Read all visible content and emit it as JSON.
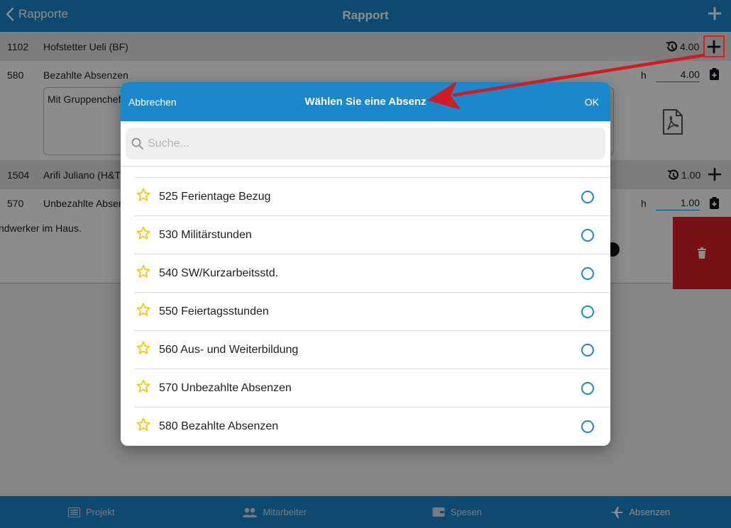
{
  "navbar": {
    "back_label": "Rapporte",
    "title": "Rapport"
  },
  "rows": [
    {
      "num": "1102",
      "name": "Hofstetter Ueli (BF)",
      "hours": "4.00"
    },
    {
      "num": "580",
      "name": "Bezahlte Absenzen",
      "unit": "h",
      "value": "4.00"
    },
    {
      "num": "1504",
      "name": "Arifi Juliano (H&T",
      "hours": "1.00"
    },
    {
      "num": "570",
      "name": "Unbezahlte Absen",
      "unit": "h",
      "value": "1.00"
    }
  ],
  "textarea_text": "Mit Gruppenchef",
  "note_text": "ndwerker im Haus.",
  "modal": {
    "cancel_label": "Abbrechen",
    "title": "Wählen Sie eine Absenz",
    "ok_label": "OK",
    "search_placeholder": "Suche...",
    "items": [
      {
        "label": "525 Ferientage Bezug"
      },
      {
        "label": "530 Militärstunden"
      },
      {
        "label": "540 SW/Kurzarbeitsstd."
      },
      {
        "label": "550 Feiertagsstunden"
      },
      {
        "label": "560 Aus- und Weiterbildung"
      },
      {
        "label": "570 Unbezahlte Absenzen"
      },
      {
        "label": "580 Bezahlte Absenzen"
      }
    ]
  },
  "tabs": [
    {
      "label": "Projekt",
      "icon": "list-icon"
    },
    {
      "label": "Mitarbeiter",
      "icon": "people-icon"
    },
    {
      "label": "Spesen",
      "icon": "wallet-icon"
    },
    {
      "label": "Absenzen",
      "icon": "airplane-icon",
      "active": true
    }
  ],
  "colors": {
    "primary": "#1b88cb",
    "delete": "#d71e26",
    "star": "#f5c400",
    "annotation": "#e31b23"
  }
}
